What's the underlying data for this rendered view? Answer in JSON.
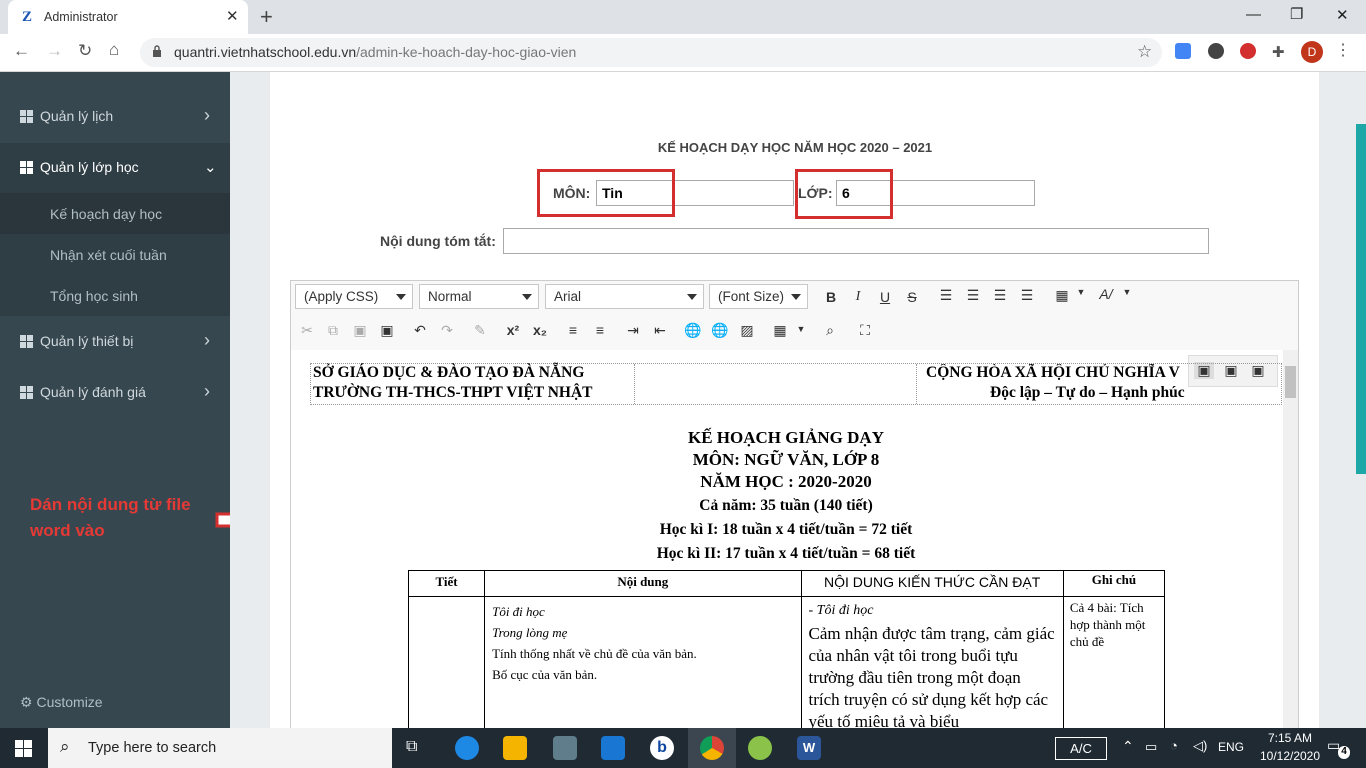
{
  "browser": {
    "tab_title": "Administrator",
    "url_host": "quantri.vietnhatschool.edu.vn",
    "url_path": "/admin-ke-hoach-day-hoc-giao-vien",
    "avatar_letter": "D"
  },
  "sidebar": {
    "items": [
      {
        "label": "Quản lý lịch"
      },
      {
        "label": "Quản lý lớp học"
      },
      {
        "label": "Quản lý thiết bị"
      },
      {
        "label": "Quản lý đánh giá"
      }
    ],
    "subitems": [
      {
        "label": "Kế hoạch dạy học"
      },
      {
        "label": "Nhận xét cuối tuần"
      },
      {
        "label": "Tổng học sinh"
      }
    ],
    "customize": "Customize"
  },
  "annotation": "Dán nội dung từ file word vào",
  "form": {
    "heading": "KẾ HOẠCH DẠY HỌC NĂM HỌC 2020 – 2021",
    "mon_label": "MÔN:",
    "mon_value": "Tin",
    "lop_label": "LỚP:",
    "lop_value": "6",
    "summary_label": "Nội dung tóm tắt:",
    "summary_value": ""
  },
  "editor": {
    "style_combo": "(Apply CSS)",
    "format_combo": "Normal",
    "font_combo": "Arial",
    "size_combo": "(Font Size)"
  },
  "document": {
    "header_left_1": "SỞ GIÁO DỤC & ĐÀO TẠO ĐÀ NẴNG",
    "header_left_2": "TRƯỜNG TH-THCS-THPT VIỆT NHẬT",
    "header_right_1": "CỘNG HÒA XÃ HỘI CHỦ NGHĨA V",
    "header_right_2": "Độc lập – Tự do – Hạnh phúc",
    "title": "KẾ HOẠCH GIẢNG DẠY",
    "subject": "MÔN: NGỮ VĂN, LỚP 8",
    "year": "NĂM HỌC : 2020-2020",
    "whole_year": "Cả năm: 35 tuần (140 tiết)",
    "term1": "Học kì I: 18 tuần x 4 tiết/tuần = 72 tiết",
    "term2": "Học kì II: 17 tuần x 4 tiết/tuần = 68 tiết",
    "table": {
      "headers": [
        "Tiết",
        "Nội dung",
        "NỘI DUNG KIẾN THỨC CẦN ĐẠT",
        "Ghi chú"
      ],
      "row1": {
        "tiet": "",
        "content_italic_1": "Tôi đi học",
        "content_italic_2": "Trong lòng mẹ",
        "content_1": "Tính thống nhất về chủ đề của văn bản.",
        "content_2": "Bố cục của văn bản.",
        "knowledge_italic": "- Tôi đi học",
        "knowledge": "Cảm nhận được tâm trạng, cảm giác của nhân vật tôi trong buổi tựu trường đầu tiên trong một đoạn trích truyện có sử dụng kết hợp các yếu tố miêu tả và biểu",
        "note": "Cả 4 bài: Tích hợp thành một chủ đề"
      }
    }
  },
  "taskbar": {
    "search_placeholder": "Type here to search",
    "input_mode": "A/C",
    "lang": "ENG",
    "time": "7:15 AM",
    "date": "10/12/2020",
    "notifications": "4"
  }
}
